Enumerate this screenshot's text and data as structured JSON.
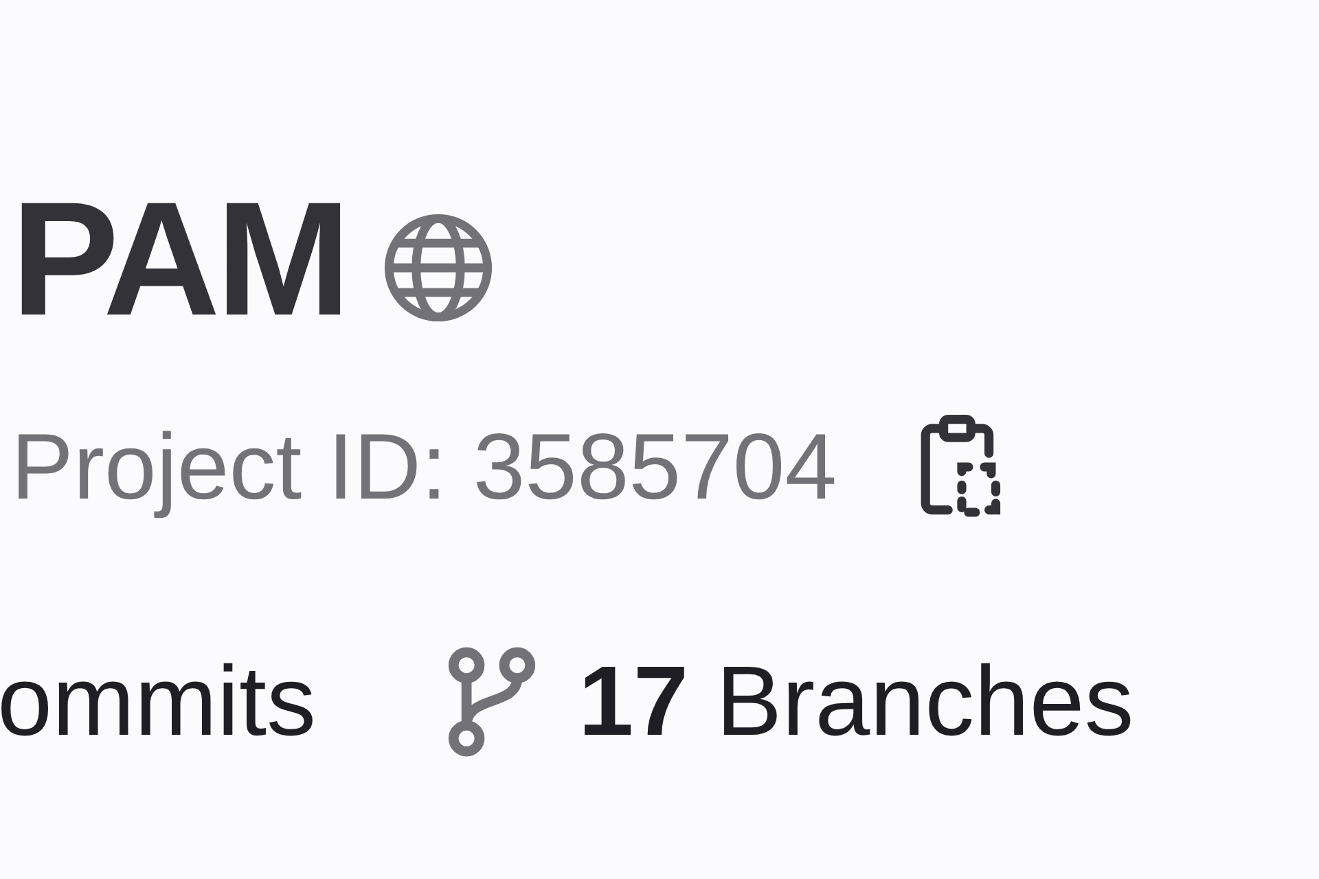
{
  "project": {
    "name": "PAM",
    "id_label": "Project ID: 3585704"
  },
  "stats": [
    {
      "kind": "text",
      "label": "ommits"
    },
    {
      "kind": "branches",
      "count": "17",
      "label": "Branches"
    }
  ]
}
